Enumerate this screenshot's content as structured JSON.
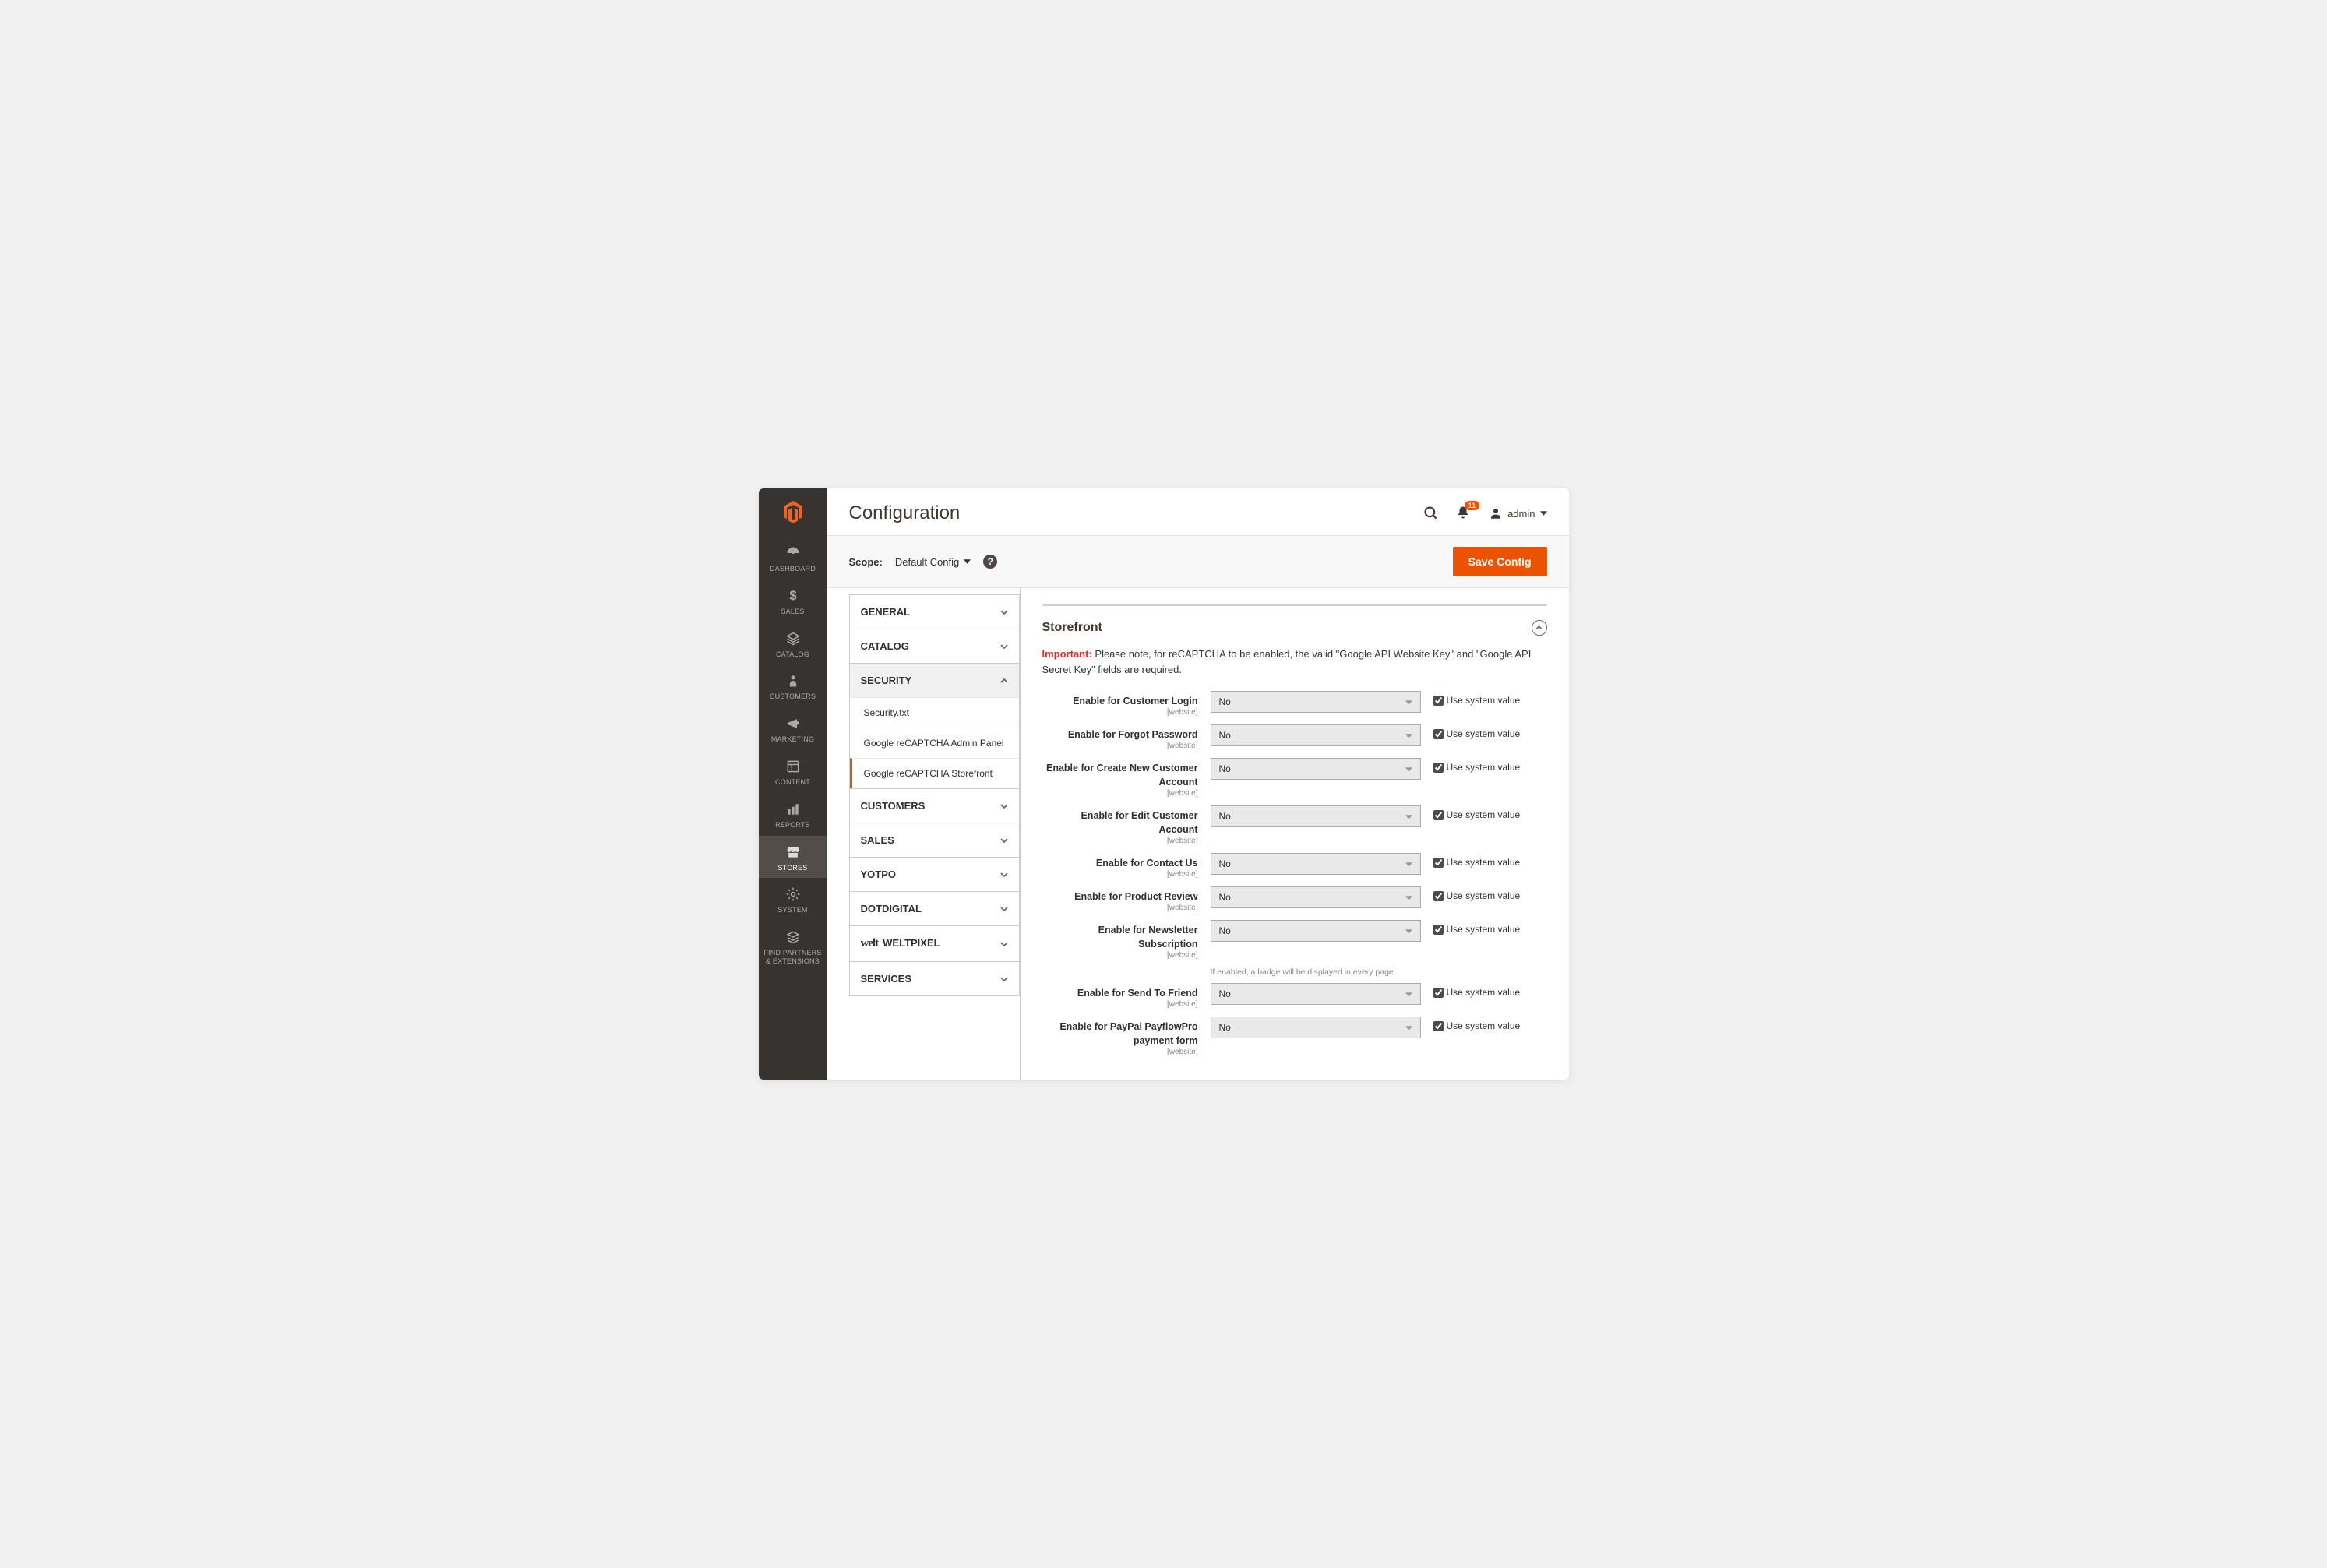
{
  "header": {
    "page_title": "Configuration",
    "notification_count": "11",
    "admin_user": "admin"
  },
  "scope_bar": {
    "label": "Scope:",
    "value": "Default Config",
    "save_button": "Save Config"
  },
  "sidebar_nav": [
    {
      "id": "dashboard",
      "label": "DASHBOARD"
    },
    {
      "id": "sales",
      "label": "SALES"
    },
    {
      "id": "catalog",
      "label": "CATALOG"
    },
    {
      "id": "customers",
      "label": "CUSTOMERS"
    },
    {
      "id": "marketing",
      "label": "MARKETING"
    },
    {
      "id": "content",
      "label": "CONTENT"
    },
    {
      "id": "reports",
      "label": "REPORTS"
    },
    {
      "id": "stores",
      "label": "STORES",
      "active": true
    },
    {
      "id": "system",
      "label": "SYSTEM"
    },
    {
      "id": "partners",
      "label": "FIND PARTNERS & EXTENSIONS"
    }
  ],
  "config_tabs": [
    {
      "label": "GENERAL",
      "open": false
    },
    {
      "label": "CATALOG",
      "open": false
    },
    {
      "label": "SECURITY",
      "open": true,
      "children": [
        {
          "label": "Security.txt",
          "active": false
        },
        {
          "label": "Google reCAPTCHA Admin Panel",
          "active": false
        },
        {
          "label": "Google reCAPTCHA Storefront",
          "active": true
        }
      ]
    },
    {
      "label": "CUSTOMERS",
      "open": false
    },
    {
      "label": "SALES",
      "open": false
    },
    {
      "label": "YOTPO",
      "open": false
    },
    {
      "label": "DOTDIGITAL",
      "open": false
    },
    {
      "label": "WELTPIXEL",
      "open": false,
      "welt": true
    },
    {
      "label": "SERVICES",
      "open": false
    }
  ],
  "section": {
    "title": "Storefront",
    "important_label": "Important:",
    "important_text": " Please note, for reCAPTCHA to be enabled, the valid \"Google API Website Key\" and \"Google API Secret Key\" fields are required.",
    "scope_note": "[website]",
    "use_system_label": "Use system value",
    "select_value": "No",
    "fields": [
      {
        "label": "Enable for Customer Login"
      },
      {
        "label": "Enable for Forgot Password"
      },
      {
        "label": "Enable for Create New Customer Account"
      },
      {
        "label": "Enable for Edit Customer Account"
      },
      {
        "label": "Enable for Contact Us"
      },
      {
        "label": "Enable for Product Review"
      },
      {
        "label": "Enable for Newsletter Subscription",
        "note": "If enabled, a badge will be displayed in every page."
      },
      {
        "label": "Enable for Send To Friend"
      },
      {
        "label": "Enable for PayPal PayflowPro payment form"
      }
    ]
  }
}
